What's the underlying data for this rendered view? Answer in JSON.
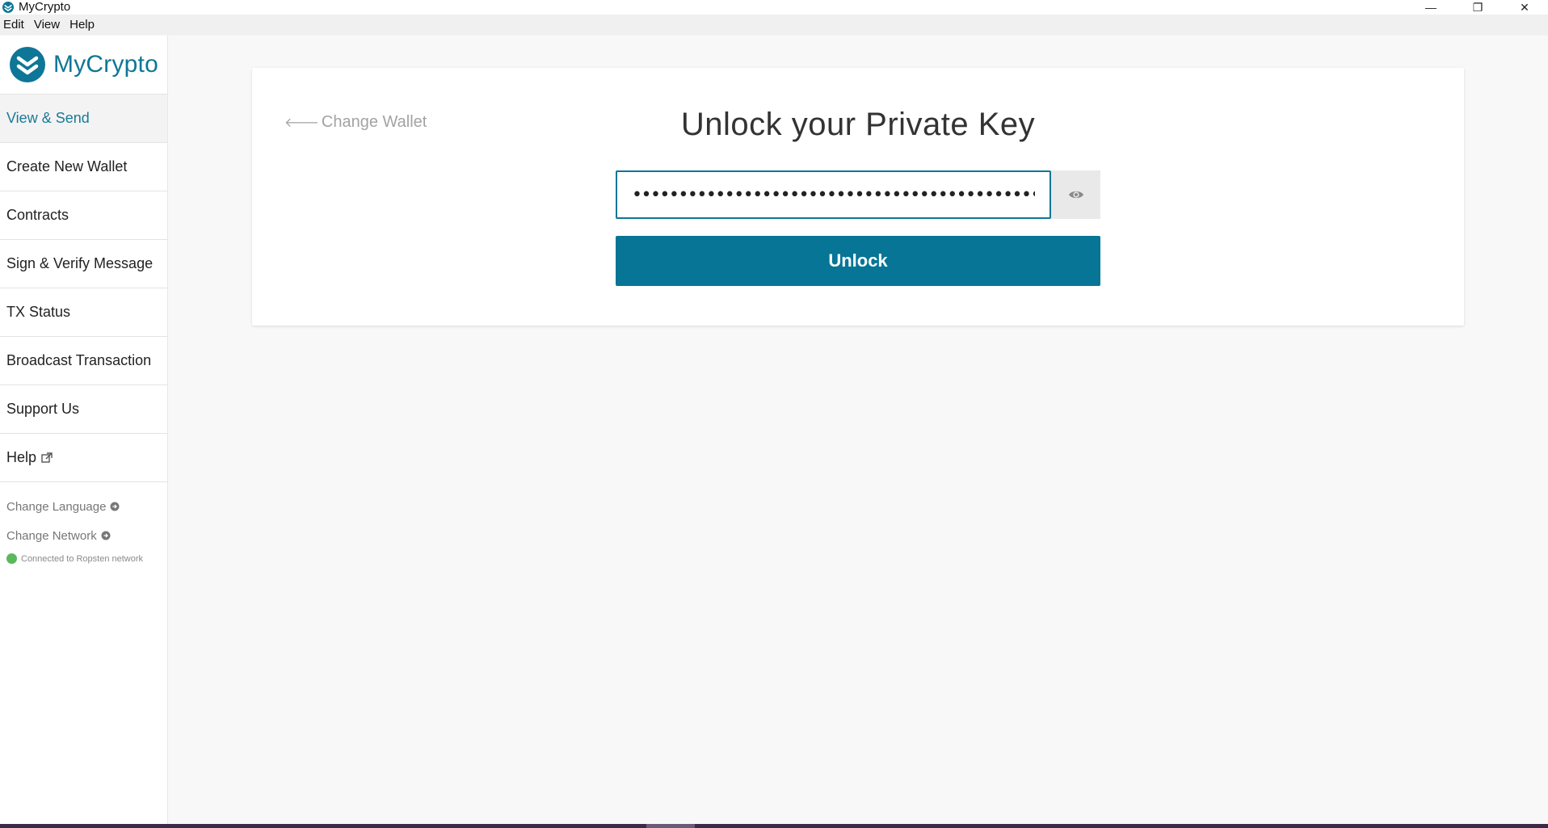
{
  "window": {
    "title": "MyCrypto",
    "controls": {
      "minimize": "—",
      "restore": "❐",
      "close": "✕"
    }
  },
  "menu": [
    "Edit",
    "View",
    "Help"
  ],
  "brand": {
    "name": "MyCrypto",
    "color": "#0e7696"
  },
  "sidebar": {
    "items": [
      {
        "label": "View & Send",
        "active": true
      },
      {
        "label": "Create New Wallet"
      },
      {
        "label": "Contracts"
      },
      {
        "label": "Sign & Verify Message"
      },
      {
        "label": "TX Status"
      },
      {
        "label": "Broadcast Transaction"
      },
      {
        "label": "Support Us"
      },
      {
        "label": "Help",
        "external": true
      }
    ],
    "change_language": "Change Language",
    "change_network": "Change Network",
    "network_status": "Connected to Ropsten network",
    "status_color": "#5cb85c"
  },
  "main": {
    "back_label": "Change Wallet",
    "title": "Unlock your Private Key",
    "key_value": "••••••••••••••••••••••••••••••••••••••••••••••••••••••••••••••••",
    "unlock_label": "Unlock",
    "accent": "#077595"
  }
}
